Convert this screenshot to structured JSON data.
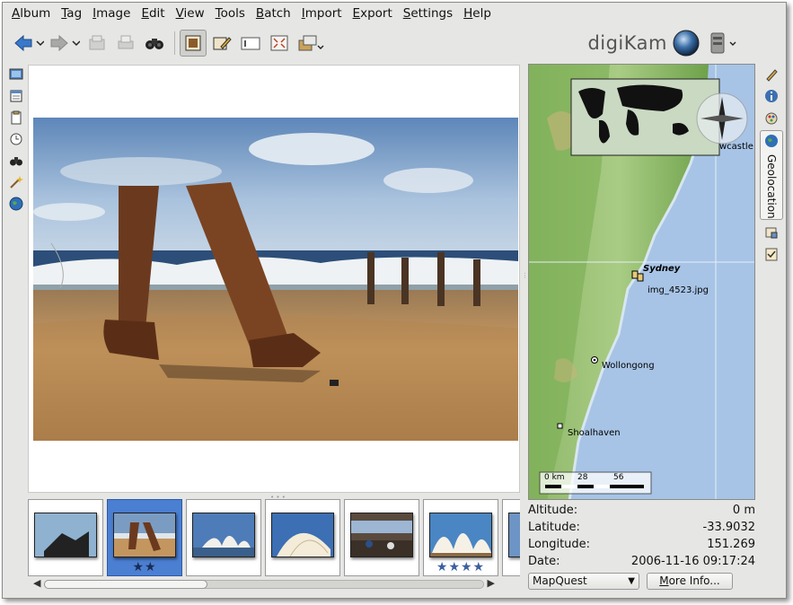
{
  "app": {
    "brand": "digiKam"
  },
  "menubar": {
    "items": [
      {
        "first": "A",
        "rest": "lbum"
      },
      {
        "first": "T",
        "rest": "ag"
      },
      {
        "first": "I",
        "rest": "mage"
      },
      {
        "first": "E",
        "rest": "dit"
      },
      {
        "first": "V",
        "rest": "iew"
      },
      {
        "first": "T",
        "rest": "ools"
      },
      {
        "first": "B",
        "rest": "atch"
      },
      {
        "first": "I",
        "rest": "mport"
      },
      {
        "first": "E",
        "rest": "xport"
      },
      {
        "first": "S",
        "rest": "ettings"
      },
      {
        "first": "H",
        "rest": "elp"
      }
    ]
  },
  "toolbar": {
    "icons": [
      "back-arrow-icon",
      "forward-arrow-icon",
      "lighttable-icon",
      "print-icon",
      "binoculars-icon",
      "preview-icon",
      "edit-icon",
      "slideshow-icon",
      "fullscreen-icon",
      "export-icon"
    ]
  },
  "map": {
    "labels": {
      "city_sydney": "Sydney",
      "photo": "img_4523.jpg",
      "wollongong": "Wollongong",
      "shoalhaven": "Shoalhaven",
      "newcastle": "wcastle"
    },
    "scale": {
      "zero": "0 km",
      "mid": "28",
      "end": "56"
    }
  },
  "info": {
    "altitude_label": "Altitude:",
    "altitude": "0 m",
    "latitude_label": "Latitude:",
    "latitude": "-33.9032",
    "longitude_label": "Longitude:",
    "longitude": "151.269",
    "date_label": "Date:",
    "date": "2006-11-16 09:17:24"
  },
  "controls": {
    "provider_selected": "MapQuest",
    "more_info_underlined": "M",
    "more_info_rest": "ore Info..."
  },
  "right_sidebar": {
    "active_tab": "Geolocation"
  },
  "thumbnails": [
    {
      "stars": ""
    },
    {
      "stars": "★★"
    },
    {
      "stars": ""
    },
    {
      "stars": ""
    },
    {
      "stars": ""
    },
    {
      "stars": "★★★★"
    },
    {
      "stars": ""
    }
  ],
  "colors": {
    "selection": "#4a7fd2",
    "window_bg": "#e6e6e4"
  }
}
